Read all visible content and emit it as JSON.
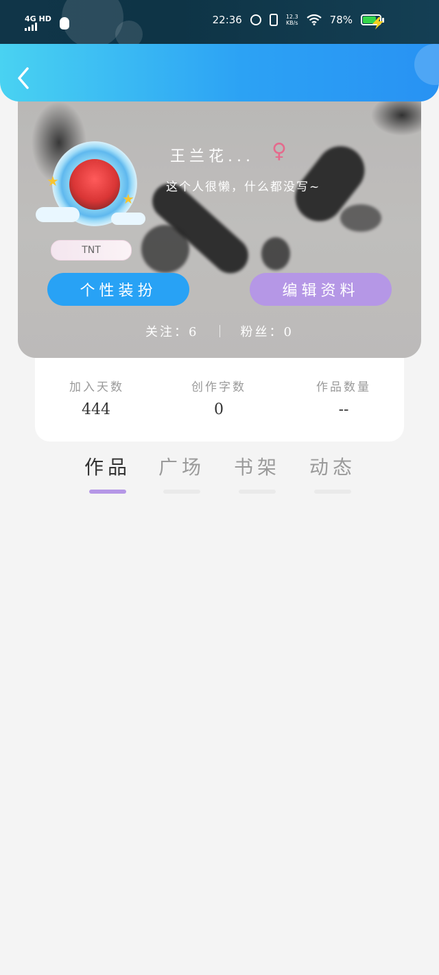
{
  "status_bar": {
    "network": "4G HD",
    "time": "22:36",
    "speed_value": "12.3",
    "speed_unit": "KB/s",
    "battery_percent": "78%",
    "battery_level": 0.78,
    "icons": [
      "qq-icon",
      "alarm-icon",
      "vibrate-icon",
      "wifi-icon",
      "battery-icon",
      "charging-icon"
    ]
  },
  "header": {
    "back_icon": "chevron-left-icon"
  },
  "profile": {
    "username": "王兰花...",
    "gender_symbol": "♀",
    "bio": "这个人很懒，什么都没写~",
    "badge": "TNT",
    "dress_button": "个性装扮",
    "edit_button": "编辑资料",
    "following_label": "关注：",
    "following_count": "6",
    "followers_label": "粉丝：",
    "followers_count": "0"
  },
  "stats": [
    {
      "label": "加入天数",
      "value": "444"
    },
    {
      "label": "创作字数",
      "value": "0"
    },
    {
      "label": "作品数量",
      "value": "--"
    }
  ],
  "tabs": [
    {
      "label": "作品",
      "active": true
    },
    {
      "label": "广场",
      "active": false
    },
    {
      "label": "书架",
      "active": false
    },
    {
      "label": "动态",
      "active": false
    }
  ],
  "colors": {
    "accent_blue": "#28a2f5",
    "accent_purple": "#b597e6",
    "status_bar": "#0e3446",
    "battery_green": "#35d54b"
  }
}
